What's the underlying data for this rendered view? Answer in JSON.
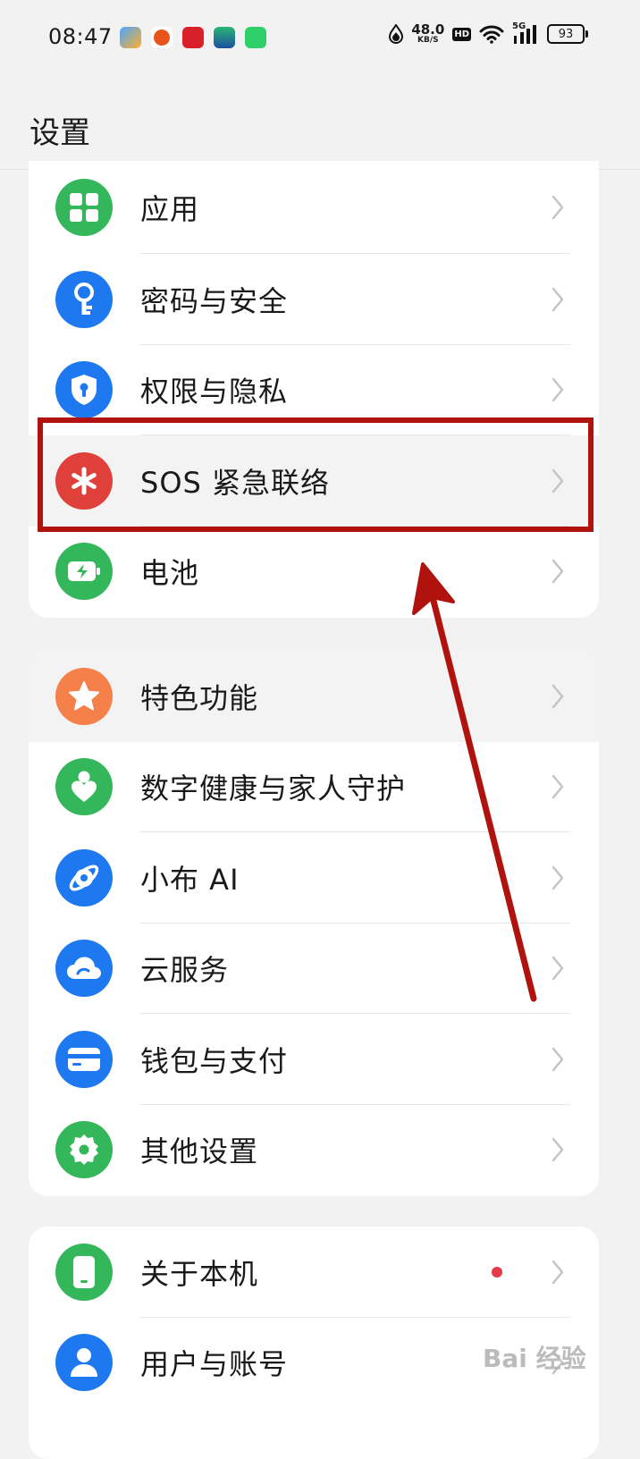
{
  "status_bar": {
    "time": "08:47",
    "speed_value": "48.0",
    "speed_unit": "KB/S",
    "hd": "HD",
    "network": "5G",
    "battery": "93"
  },
  "header": {
    "title": "设置"
  },
  "groups": [
    {
      "items": [
        {
          "label": "应用",
          "icon": "apps-grid-icon",
          "color": "#34b65a"
        },
        {
          "label": "密码与安全",
          "icon": "key-icon",
          "color": "#1e78f0"
        },
        {
          "label": "权限与隐私",
          "icon": "shield-lock-icon",
          "color": "#1e78f0"
        },
        {
          "label": "SOS 紧急联络",
          "icon": "asterisk-icon",
          "color": "#e0403a"
        },
        {
          "label": "电池",
          "icon": "battery-charging-icon",
          "color": "#34b65a"
        }
      ]
    },
    {
      "items": [
        {
          "label": "特色功能",
          "icon": "star-icon",
          "color": "#f5804a"
        },
        {
          "label": "数字健康与家人守护",
          "icon": "person-heart-icon",
          "color": "#34b65a"
        },
        {
          "label": "小布 AI",
          "icon": "ai-orbit-icon",
          "color": "#1e78f0"
        },
        {
          "label": "云服务",
          "icon": "cloud-icon",
          "color": "#1e78f0"
        },
        {
          "label": "钱包与支付",
          "icon": "card-icon",
          "color": "#1e78f0"
        },
        {
          "label": "其他设置",
          "icon": "gear-icon",
          "color": "#34b65a"
        }
      ]
    },
    {
      "items": [
        {
          "label": "关于本机",
          "icon": "phone-icon",
          "color": "#34b65a"
        },
        {
          "label": "用户与账号",
          "icon": "user-icon",
          "color": "#1e78f0"
        }
      ]
    }
  ],
  "annotation_color": "#b0120e",
  "watermark": "Bai 经验"
}
